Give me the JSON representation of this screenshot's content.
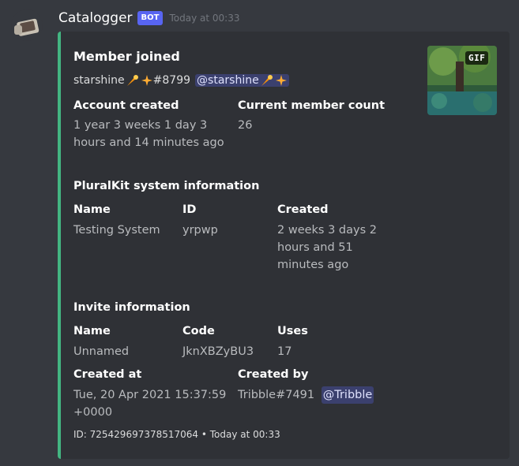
{
  "message": {
    "username": "Catalogger",
    "bot_tag": "BOT",
    "timestamp": "Today at 00:33"
  },
  "embed": {
    "accent_color": "#43b581",
    "title": "Member joined",
    "description": {
      "user_tag_start": "starshine",
      "user_tag_end": "#8799",
      "mention": "@starshine"
    },
    "thumbnail_badge": "GIF",
    "fields": [
      {
        "name": "Account created",
        "value": "1 year 3 weeks 1 day 3 hours and 14 minutes ago"
      },
      {
        "name": "Current member count",
        "value": "26"
      },
      {
        "name": "PluralKit system information",
        "value": ""
      },
      {
        "name": "Name",
        "value": "Testing System"
      },
      {
        "name": "ID",
        "value": "yrpwp"
      },
      {
        "name": "Created",
        "value": "2 weeks 3 days 2 hours and 51 minutes ago"
      },
      {
        "name": "Invite information",
        "value": ""
      },
      {
        "name": "Name",
        "value": "Unnamed"
      },
      {
        "name": "Code",
        "value": "JknXBZyBU3"
      },
      {
        "name": "Uses",
        "value": "17"
      },
      {
        "name": "Created at",
        "value": "Tue, 20 Apr 2021 15:37:59 +0000"
      },
      {
        "name": "Created by",
        "value": "Tribble#7491",
        "mention": "@Tribble"
      }
    ],
    "footer": "ID: 725429697378517064 • Today at 00:33"
  }
}
